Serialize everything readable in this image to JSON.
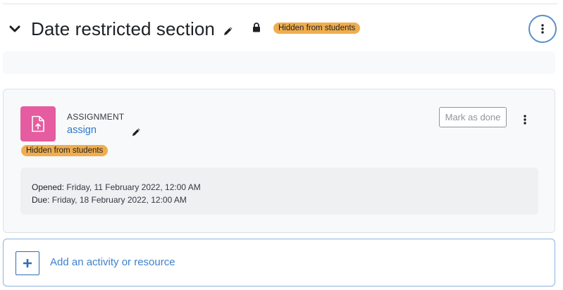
{
  "section": {
    "title": "Date restricted section",
    "badge": "Hidden from students"
  },
  "activity": {
    "type": "ASSIGNMENT",
    "name": "assign",
    "badge": "Hidden from students",
    "mark_done_label": "Mark as done",
    "dates": {
      "opened_label": "Opened:",
      "opened_value": "Friday, 11 February 2022, 12:00 AM",
      "due_label": "Due:",
      "due_value": "Friday, 18 February 2022, 12:00 AM"
    }
  },
  "add_activity": {
    "label": "Add an activity or resource"
  },
  "colors": {
    "badge_warning": "#f0ad4e",
    "assignment_icon_bg": "#e65ca0",
    "link": "#2f78c8",
    "focus_ring": "#5b8fc7"
  },
  "icons": {
    "collapse": "chevron-down-icon",
    "edit": "pencil-icon",
    "lock": "lock-icon",
    "menu": "kebab-icon",
    "assignment": "assignment-upload-icon",
    "add": "plus-icon"
  }
}
